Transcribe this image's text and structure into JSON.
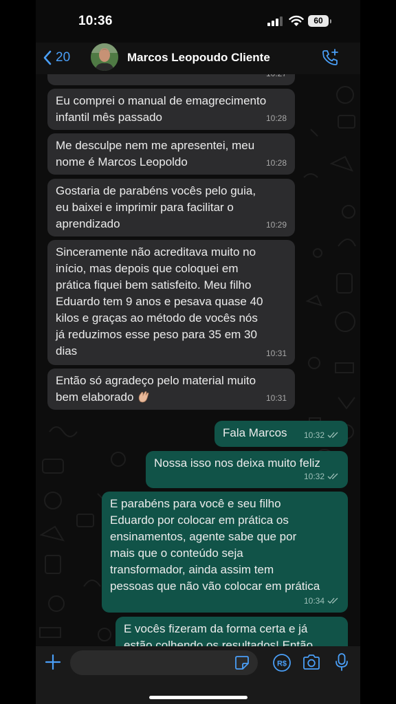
{
  "status_bar": {
    "time": "10:36",
    "battery": "60"
  },
  "header": {
    "back_count": "20",
    "contact_name": "Marcos Leopoudo Cliente"
  },
  "messages": [
    {
      "text": "",
      "time": "10:27"
    },
    {
      "text": "Eu comprei o manual de emagrecimento\ninfantil mês passado",
      "time": "10:28"
    },
    {
      "text": "Me desculpe nem me apresentei, meu\nnome é Marcos Leopoldo",
      "time": "10:28"
    },
    {
      "text": "Gostaria de parabéns vocês pelo guia,\neu baixei e imprimir para facilitar o\naprendizado",
      "time": "10:29"
    },
    {
      "text": "Sinceramente não acreditava muito no\ninício, mas depois que coloquei em\nprática fiquei bem satisfeito. Meu filho\nEduardo tem 9 anos e pesava quase 40\nkilos e graças ao método de vocês nós\njá reduzimos esse peso para 35 em 30\ndias",
      "time": "10:31"
    },
    {
      "text": "Então só agradeço pelo material muito\nbem elaborado",
      "emoji": "clapping-hands",
      "time": "10:31"
    },
    {
      "text": "Fala Marcos",
      "time": "10:32"
    },
    {
      "text": "Nossa isso nos deixa muito feliz",
      "time": "10:32"
    },
    {
      "text": "E parabéns para você e seu filho\nEduardo por colocar em prática os\nensinamentos, agente sabe que por\nmais que o conteúdo seja\ntransformador, ainda assim tem\npessoas que não vão colocar em prática",
      "time": "10:34"
    },
    {
      "text": "E vocês fizeram da forma certa e já\nestão colhendo os resultados! Então",
      "time": ""
    }
  ],
  "icons": {
    "back": "chevron-left-icon",
    "call": "add-call-icon",
    "attach": "plus-icon",
    "sticker": "sticker-icon",
    "payment": "pix-icon",
    "camera": "camera-icon",
    "mic": "microphone-icon",
    "read": "double-check-icon"
  },
  "colors": {
    "incoming_bubble": "#2c2c2e",
    "outgoing_bubble": "#115348",
    "accent": "#4a9ff7",
    "background": "#0d0d0d"
  }
}
